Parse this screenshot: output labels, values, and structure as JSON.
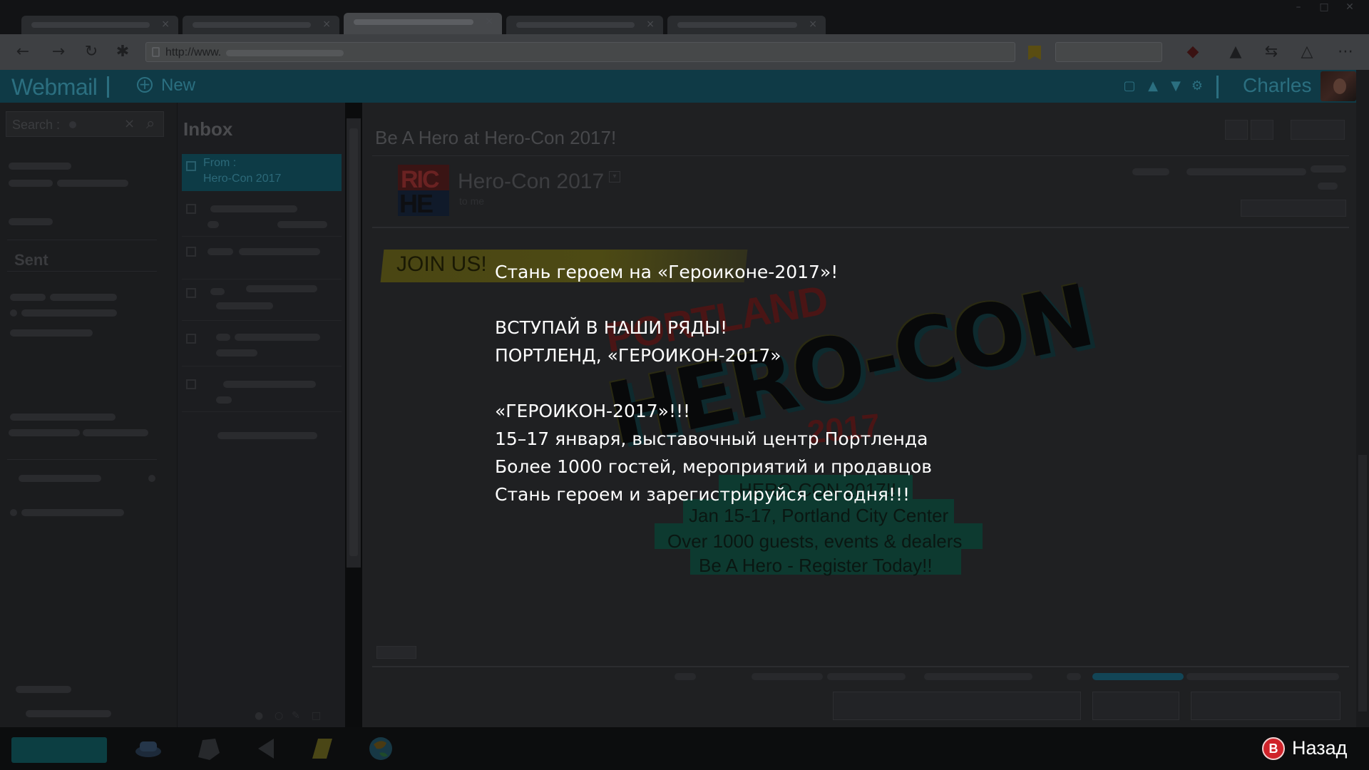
{
  "browser": {
    "url_prefix": "http://www."
  },
  "webmail": {
    "brand": "Webmail",
    "new_label": "New",
    "user_name": "Charles"
  },
  "folders": {
    "search_placeholder": "Search :",
    "sent_label": "Sent"
  },
  "inbox": {
    "title": "Inbox",
    "selected_from": "From :",
    "selected_sender": "Hero-Con 2017"
  },
  "email": {
    "subject": "Be A Hero at Hero-Con 2017!",
    "sender": "Hero-Con 2017",
    "to": "to me",
    "logo_top": "RIC",
    "logo_bottom": "HE",
    "banner": "JOIN US!",
    "art_portland": "PORTLAND",
    "art_logo": "HERO-CON",
    "art_year": "2017",
    "info_lines": [
      "HERO-CON 2017!!",
      "Jan 15-17, Portland City Center",
      "Over 1000 guests, events & dealers",
      "Be A Hero - Register Today!!"
    ]
  },
  "subtitles": {
    "line1": "Стань героем на «Героиконе-2017»!",
    "line2": "ВСТУПАЙ В НАШИ РЯДЫ!",
    "line3": "ПОРТЛЕНД, «ГЕРОИКОН-2017»",
    "line4": "«ГЕРОИКОН-2017»!!!",
    "line5": "15–17 января, выставочный центр Портленда",
    "line6": "Более 1000 гостей, мероприятий и продавцов",
    "line7": "Стань героем и зарегистрируйся сегодня!!!"
  },
  "prompt": {
    "button": "B",
    "label": "Назад"
  },
  "colors": {
    "accent_dim": "#0f3a46",
    "back_button": "#d0232a"
  }
}
